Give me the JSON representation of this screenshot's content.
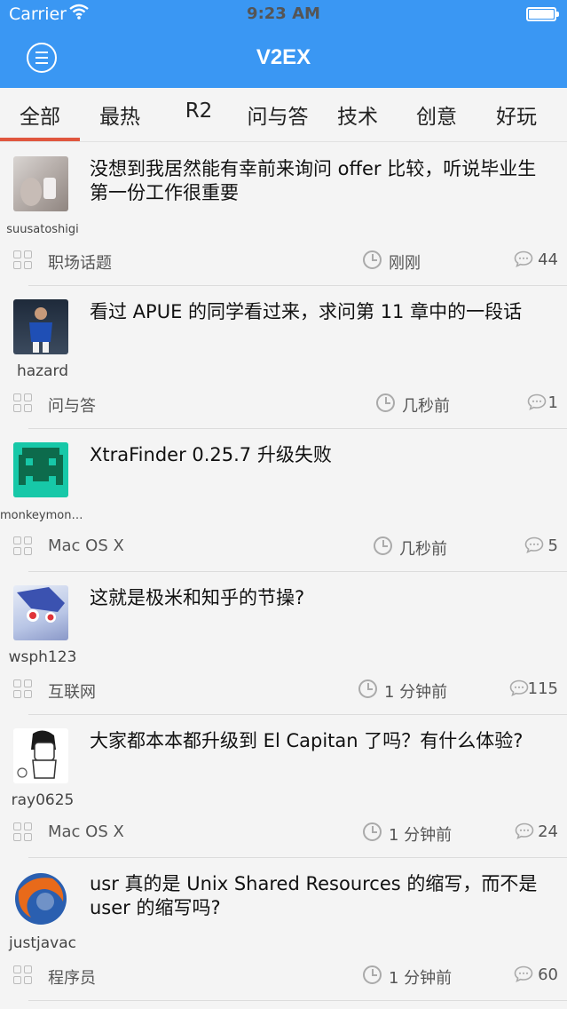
{
  "status_bar": {
    "carrier": "Carrier",
    "time": "9:23 AM",
    "wifi_icon": "wifi-icon",
    "battery_icon": "battery-icon"
  },
  "nav": {
    "title": "V2EX",
    "menu_icon": "menu-icon"
  },
  "tabs": [
    {
      "label": "全部",
      "selected": true
    },
    {
      "label": "最热"
    },
    {
      "label": "R2"
    },
    {
      "label": "问与答"
    },
    {
      "label": "技术"
    },
    {
      "label": "创意"
    },
    {
      "label": "好玩"
    }
  ],
  "topics": [
    {
      "username": "suusatoshigi",
      "title": "没想到我居然能有幸前来询问 offer 比较，听说毕业生第一份工作很重要",
      "node": "职场话题",
      "time": "刚刚",
      "replies": "44"
    },
    {
      "username": "hazard",
      "title": "看过 APUE 的同学看过来，求问第 11 章中的一段话",
      "node": "问与答",
      "time": "几秒前",
      "replies": "1"
    },
    {
      "username": "monkeymonk…",
      "title": "XtraFinder 0.25.7 升级失败",
      "node": "Mac OS X",
      "time": "几秒前",
      "replies": "5"
    },
    {
      "username": "wsph123",
      "title": "这就是极米和知乎的节操?",
      "node": "互联网",
      "time": "1 分钟前",
      "replies": "115"
    },
    {
      "username": "ray0625",
      "title": "大家都本本都升级到 El Capitan 了吗？有什么体验?",
      "node": "Mac OS X",
      "time": "1 分钟前",
      "replies": "24"
    },
    {
      "username": "justjavac",
      "title": "usr 真的是 Unix Shared Resources 的缩写，而不是 user 的缩写吗?",
      "node": "程序员",
      "time": "1 分钟前",
      "replies": "60"
    }
  ],
  "colors": {
    "accent": "#3a97f3",
    "tab_indicator": "#e0563e"
  }
}
